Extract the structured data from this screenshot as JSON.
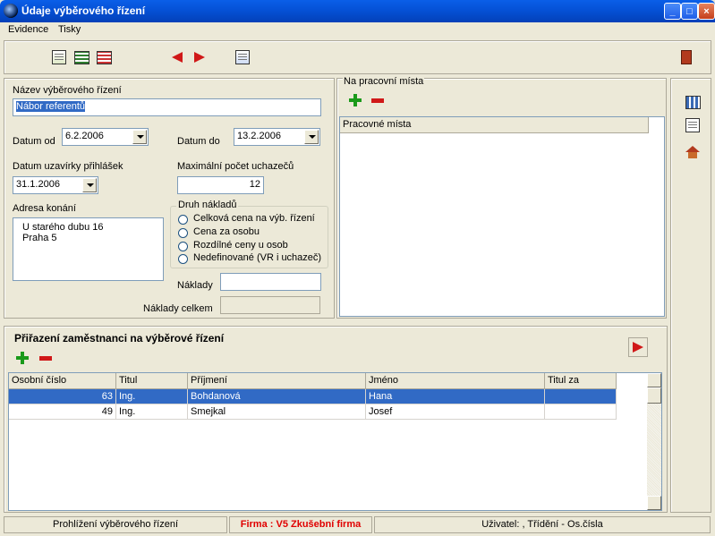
{
  "window": {
    "title": "Údaje výběrového řízení"
  },
  "menu": {
    "items": [
      "Evidence",
      "Tisky"
    ]
  },
  "form": {
    "nazev_label": "Název výběrového řízení",
    "nazev_value": "Nábor referentů",
    "datum_od_label": "Datum od",
    "datum_od_value": "6.2.2006",
    "datum_do_label": "Datum do",
    "datum_do_value": "13.2.2006",
    "datum_uzaverky_label": "Datum uzavírky přihlášek",
    "datum_uzaverky_value": "31.1.2006",
    "max_pocet_label": "Maximální počet uchazečů",
    "max_pocet_value": "12",
    "adresa_label": "Adresa konání",
    "adresa_lines": [
      "U starého dubu 16",
      "Praha 5"
    ],
    "druh_nakladu_label": "Druh nákladů",
    "druh_nakladu_options": [
      "Celková cena na výb. řízení",
      "Cena za osobu",
      "Rozdílné ceny u osob",
      "Nedefinované (VR i uchazeč)"
    ],
    "naklady_label": "Náklady",
    "naklady_value": "",
    "naklady_celkem_label": "Náklady celkem",
    "naklady_celkem_value": ""
  },
  "pracovni_mista": {
    "group_label": "Na pracovní místa",
    "column_header": "Pracovné místa"
  },
  "prirazeni": {
    "title": "Přiřazení zaměstnanci na výběrové řízení",
    "columns": [
      "Osobní číslo",
      "Titul",
      "Příjmení",
      "Jméno",
      "Titul za"
    ],
    "rows": [
      [
        "63",
        "Ing.",
        "Bohdanová",
        "Hana",
        ""
      ],
      [
        "49",
        "Ing.",
        "Smejkal",
        "Josef",
        ""
      ]
    ]
  },
  "status": {
    "mode": "Prohlížení výběrového řízení",
    "firma": "Firma :  V5 Zkušební firma",
    "uzivatel": "Uživatel: , Třídění - Os.čísla"
  },
  "colors": {
    "accent": "#316AC5",
    "firma_text": "#E00000",
    "titlebar": "#0551D6"
  }
}
